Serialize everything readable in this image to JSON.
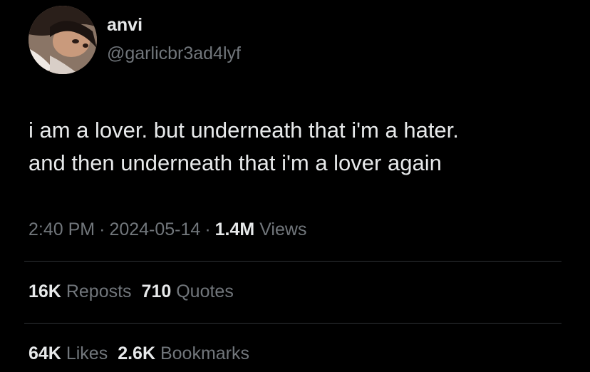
{
  "author": {
    "display_name": "anvi",
    "handle": "@garlicbr3ad4lyf"
  },
  "tweet": {
    "lines": [
      "i am a lover. but underneath that i'm a hater.",
      "and then underneath that i'm a lover again"
    ]
  },
  "meta": {
    "time": "2:40 PM",
    "separator": "·",
    "date": "2024-05-14",
    "views_count": "1.4M",
    "views_label": "Views"
  },
  "stats": {
    "reposts_count": "16K",
    "reposts_label": "Reposts",
    "quotes_count": "710",
    "quotes_label": "Quotes",
    "likes_count": "64K",
    "likes_label": "Likes",
    "bookmarks_count": "2.6K",
    "bookmarks_label": "Bookmarks"
  },
  "colors": {
    "background": "#000000",
    "primary_text": "#e7e9ea",
    "secondary_text": "#71767b",
    "divider": "#2f3336"
  }
}
